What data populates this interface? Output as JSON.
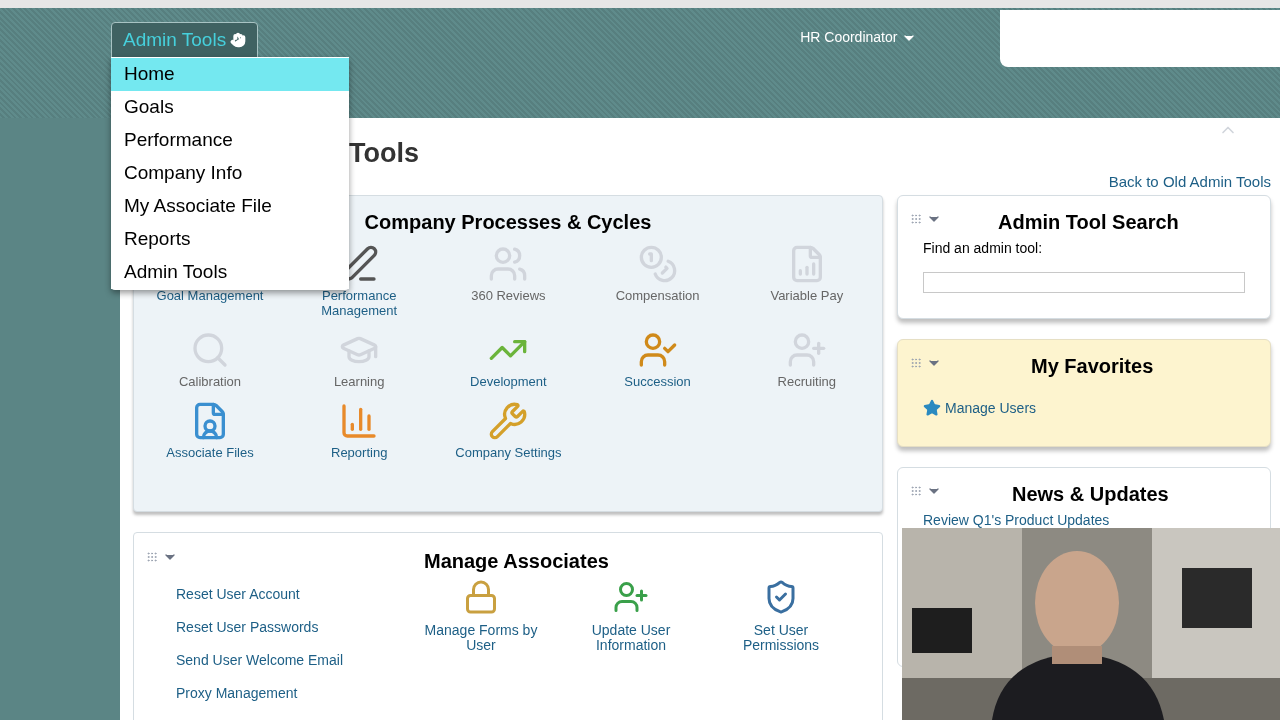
{
  "header": {
    "menu_button": "Admin Tools",
    "user_menu": "HR Coordinator"
  },
  "dropdown": {
    "items": [
      {
        "label": "Home",
        "selected": true
      },
      {
        "label": "Goals",
        "selected": false
      },
      {
        "label": "Performance",
        "selected": false
      },
      {
        "label": "Company Info",
        "selected": false
      },
      {
        "label": "My Associate File",
        "selected": false
      },
      {
        "label": "Reports",
        "selected": false
      },
      {
        "label": "Admin Tools",
        "selected": false
      }
    ]
  },
  "page": {
    "title": "Tools",
    "back_link": "Back to Old Admin Tools"
  },
  "processes": {
    "title": "Company Processes & Cycles",
    "tiles": [
      {
        "label": "Goal Management",
        "kind": "goal",
        "enabled": true
      },
      {
        "label": "Performance Management",
        "kind": "performance",
        "enabled": true
      },
      {
        "label": "360 Reviews",
        "kind": "reviews",
        "enabled": false
      },
      {
        "label": "Compensation",
        "kind": "compensation",
        "enabled": false
      },
      {
        "label": "Variable Pay",
        "kind": "pay",
        "enabled": false
      },
      {
        "label": "Calibration",
        "kind": "calibration",
        "enabled": false
      },
      {
        "label": "Learning",
        "kind": "learning",
        "enabled": false
      },
      {
        "label": "Development",
        "kind": "development",
        "enabled": true
      },
      {
        "label": "Succession",
        "kind": "succession",
        "enabled": true
      },
      {
        "label": "Recruiting",
        "kind": "recruiting",
        "enabled": false
      },
      {
        "label": "Associate Files",
        "kind": "files",
        "enabled": true
      },
      {
        "label": "Reporting",
        "kind": "reporting",
        "enabled": true
      },
      {
        "label": "Company Settings",
        "kind": "settings",
        "enabled": true
      }
    ]
  },
  "associates": {
    "title": "Manage Associates",
    "links": [
      "Reset User Account",
      "Reset User Passwords",
      "Send User Welcome Email",
      "Proxy Management"
    ],
    "tiles": [
      {
        "label": "Manage Forms by User",
        "kind": "lock"
      },
      {
        "label": "Update User Information",
        "kind": "users"
      },
      {
        "label": "Set User Permissions",
        "kind": "permissions"
      }
    ]
  },
  "search_panel": {
    "title": "Admin Tool Search",
    "field_label": "Find an admin tool:"
  },
  "favorites": {
    "title": "My Favorites",
    "items": [
      "Manage Users"
    ]
  },
  "news": {
    "title": "News & Updates",
    "items": [
      "Review Q1's Product Updates"
    ]
  }
}
